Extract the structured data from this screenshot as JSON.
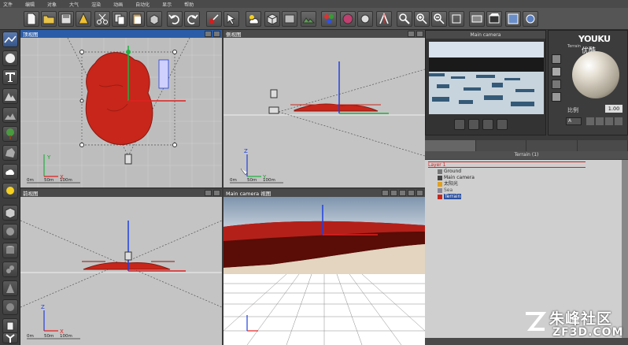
{
  "menu": [
    "文件",
    "编辑",
    "对象",
    "大气",
    "渲染",
    "动画",
    "自动化",
    "显示",
    "帮助"
  ],
  "viewports": {
    "top": {
      "title": "顶视图"
    },
    "side": {
      "title": "侧视图"
    },
    "front": {
      "title": "前视图"
    },
    "camera": {
      "title": "Main camera 视图"
    }
  },
  "axis_labels": {
    "x": "X",
    "y": "Y",
    "z": "Z"
  },
  "scale_labels": [
    "0m",
    "50m",
    "100m"
  ],
  "camera_panel": {
    "title": "Main camera"
  },
  "material_panel": {
    "logo": "YOUKU",
    "logo_cn": "优酷",
    "name": "Terrain",
    "scale_label": "比例",
    "scale_value": "1.00",
    "dropdown": "A"
  },
  "scene_panel": {
    "header": "Terrain (1)",
    "tree": [
      {
        "label": "Layer 1",
        "type": "layer"
      },
      {
        "label": "Ground",
        "type": "item"
      },
      {
        "label": "Main camera",
        "type": "item"
      },
      {
        "label": "太阳光",
        "type": "item"
      },
      {
        "label": "Sea",
        "type": "item"
      },
      {
        "label": "Terrain",
        "type": "selected"
      }
    ]
  },
  "watermark": {
    "brand": "朱峰社区",
    "url": "ZF3D.COM"
  },
  "colors": {
    "terrain": "#c8261b",
    "active_header": "#2b5ca8",
    "axis_x": "#e02020",
    "axis_y": "#20b040",
    "axis_z": "#2040e0"
  }
}
